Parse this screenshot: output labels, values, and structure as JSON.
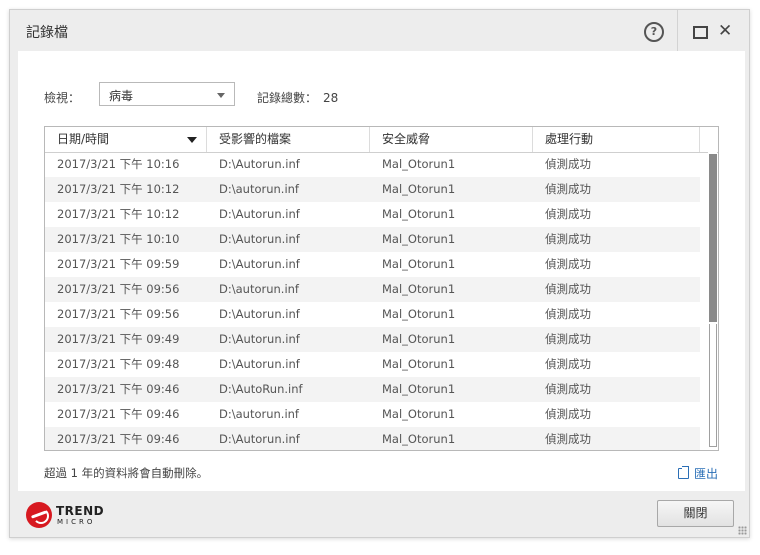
{
  "window": {
    "title": "記錄檔"
  },
  "filter": {
    "label": "檢視：",
    "selected": "病毒"
  },
  "summary": {
    "label": "記錄總數：",
    "count": "28"
  },
  "table": {
    "columns": [
      "日期/時間",
      "受影響的檔案",
      "安全威脅",
      "處理行動"
    ],
    "rows": [
      [
        "2017/3/21 下午 10:16",
        "D:\\Autorun.inf",
        "Mal_Otorun1",
        "偵測成功"
      ],
      [
        "2017/3/21 下午 10:12",
        "D:\\autorun.inf",
        "Mal_Otorun1",
        "偵測成功"
      ],
      [
        "2017/3/21 下午 10:12",
        "D:\\Autorun.inf",
        "Mal_Otorun1",
        "偵測成功"
      ],
      [
        "2017/3/21 下午 10:10",
        "D:\\Autorun.inf",
        "Mal_Otorun1",
        "偵測成功"
      ],
      [
        "2017/3/21 下午 09:59",
        "D:\\Autorun.inf",
        "Mal_Otorun1",
        "偵測成功"
      ],
      [
        "2017/3/21 下午 09:56",
        "D:\\autorun.inf",
        "Mal_Otorun1",
        "偵測成功"
      ],
      [
        "2017/3/21 下午 09:56",
        "D:\\Autorun.inf",
        "Mal_Otorun1",
        "偵測成功"
      ],
      [
        "2017/3/21 下午 09:49",
        "D:\\Autorun.inf",
        "Mal_Otorun1",
        "偵測成功"
      ],
      [
        "2017/3/21 下午 09:48",
        "D:\\Autorun.inf",
        "Mal_Otorun1",
        "偵測成功"
      ],
      [
        "2017/3/21 下午 09:46",
        "D:\\AutoRun.inf",
        "Mal_Otorun1",
        "偵測成功"
      ],
      [
        "2017/3/21 下午 09:46",
        "D:\\autorun.inf",
        "Mal_Otorun1",
        "偵測成功"
      ],
      [
        "2017/3/21 下午 09:46",
        "D:\\Autorun.inf",
        "Mal_Otorun1",
        "偵測成功"
      ]
    ]
  },
  "footer": {
    "note": "超過 1 年的資料將會自動刪除。",
    "export_label": "匯出",
    "close_label": "關閉"
  },
  "logo": {
    "line1": "TREND",
    "line2": "MICRO"
  },
  "colors": {
    "accent_link": "#2b6fb6",
    "brand_red": "#d71920",
    "scroll_thumb": "#8a8a8a"
  }
}
